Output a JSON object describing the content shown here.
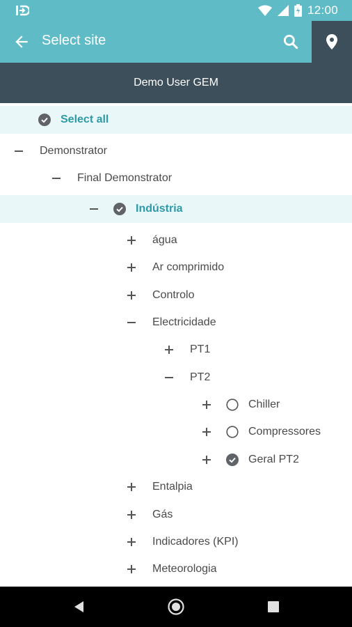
{
  "status_bar": {
    "time": "12:00"
  },
  "app_bar": {
    "title": "Select site"
  },
  "header": {
    "user": "Demo User GEM"
  },
  "select_all": {
    "label": "Select all"
  },
  "tree": {
    "demonstrator": "Demonstrator",
    "final_demonstrator": "Final Demonstrator",
    "industria": "Indústria",
    "agua": "água",
    "ar_comprimido": "Ar comprimido",
    "controlo": "Controlo",
    "electricidade": "Electricidade",
    "pt1": "PT1",
    "pt2": "PT2",
    "chiller": "Chiller",
    "compressores": "Compressores",
    "geral_pt2": "Geral PT2",
    "entalpia": "Entalpia",
    "gas": "Gás",
    "indicadores": "Indicadores (KPI)",
    "meteorologia": "Meteorologia"
  },
  "colors": {
    "accent": "#5fbcc7",
    "dark": "#3c4f5a",
    "highlight": "#eaf7f9",
    "selected_text": "#2e9aa6"
  },
  "icons": [
    "back-arrow-icon",
    "search-icon",
    "location-pin-icon",
    "check-circle-icon",
    "radio-empty-icon",
    "plus-icon",
    "minus-icon"
  ]
}
